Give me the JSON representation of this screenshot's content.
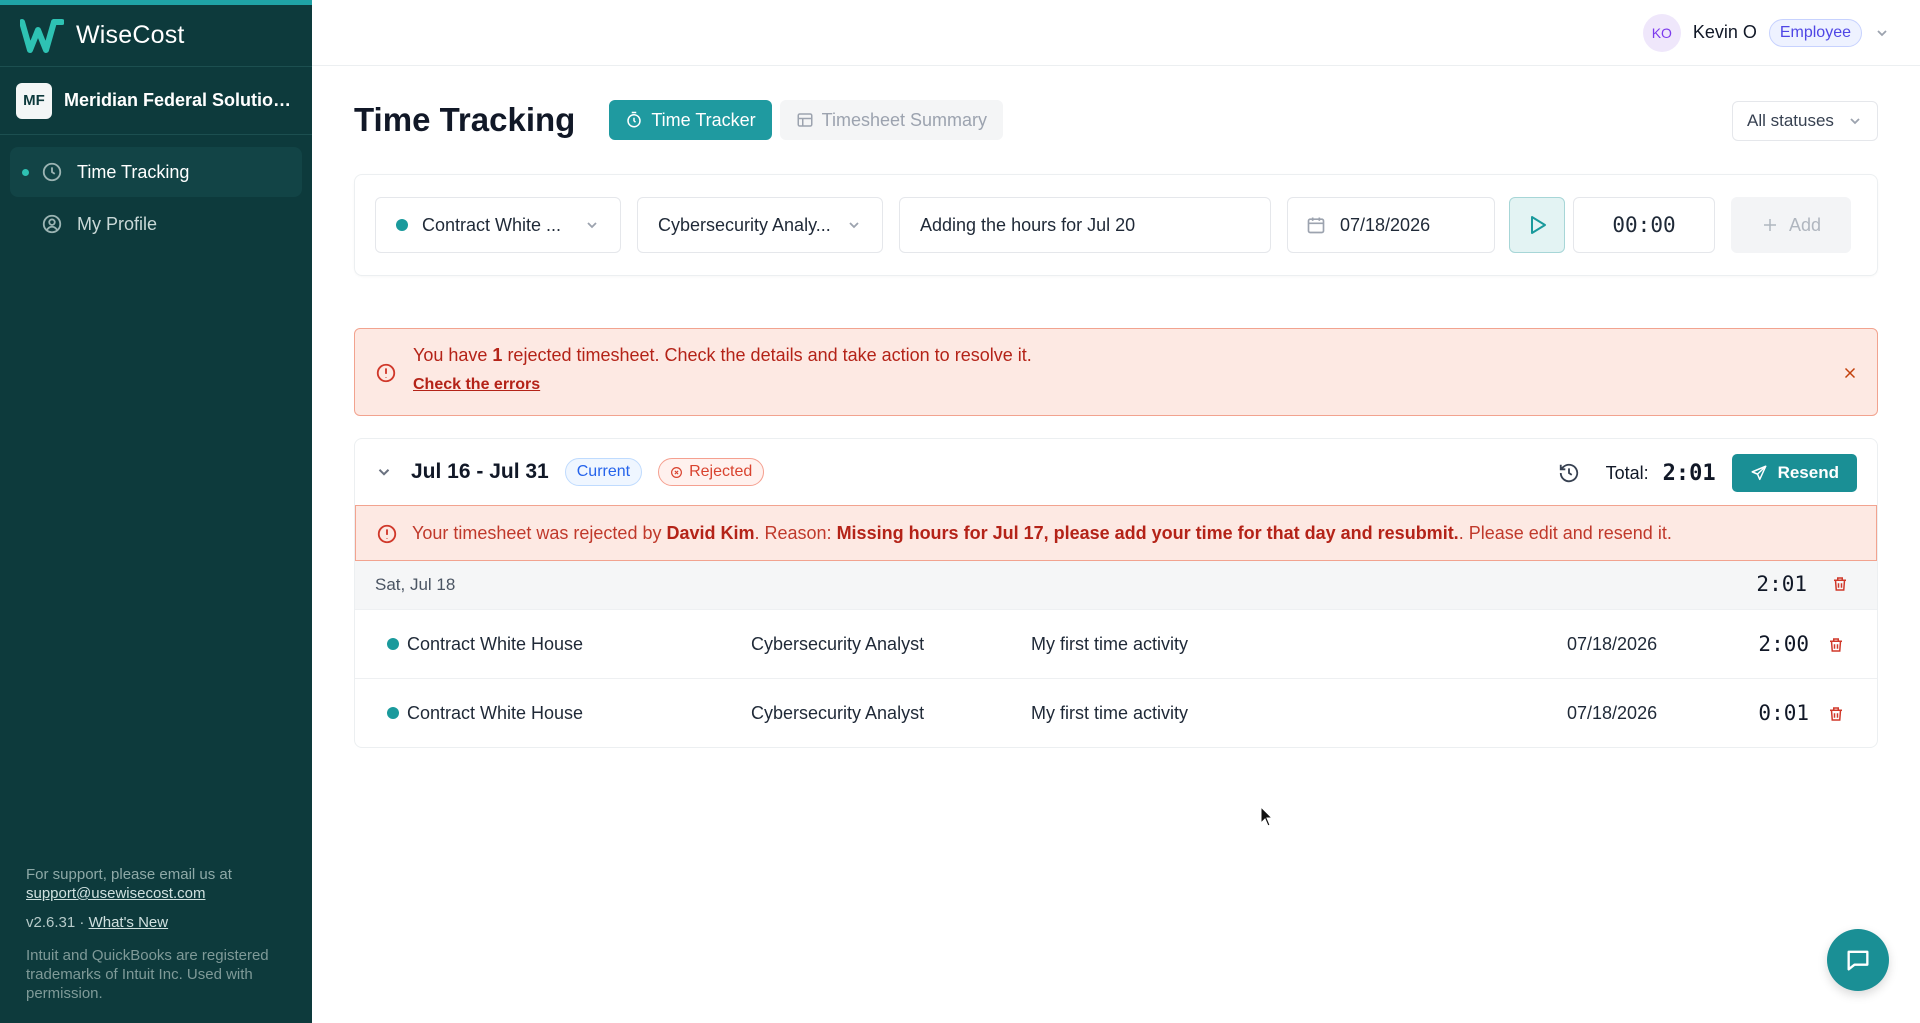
{
  "app": {
    "name": "WiseCost"
  },
  "org": {
    "initials": "MF",
    "name": "Meridian Federal Solutions..."
  },
  "nav": [
    {
      "label": "Time Tracking",
      "icon": "clock-icon",
      "active": true
    },
    {
      "label": "My Profile",
      "icon": "user-circle-icon",
      "active": false
    }
  ],
  "footer": {
    "support_text": "For support, please email us at",
    "support_email": "support@usewisecost.com",
    "version": "v2.6.31",
    "version_sep": " · ",
    "whats_new": "What's New",
    "legal": "Intuit and QuickBooks are registered trademarks of Intuit Inc. Used with permission."
  },
  "user": {
    "initials": "KO",
    "name": "Kevin O",
    "role": "Employee"
  },
  "page": {
    "title": "Time Tracking",
    "tabs": [
      {
        "label": "Time Tracker",
        "active": true
      },
      {
        "label": "Timesheet Summary",
        "active": false
      }
    ],
    "status_filter": "All statuses"
  },
  "entry_form": {
    "project": "Contract White ...",
    "role": "Cybersecurity Analy...",
    "description": "Adding the hours for Jul 20",
    "date": "07/18/2026",
    "timer": "00:00",
    "add_label": "Add"
  },
  "alert": {
    "prefix": "You have ",
    "count": "1",
    "suffix": " rejected timesheet. Check the details and take action to resolve it.",
    "link": "Check the errors"
  },
  "timesheet": {
    "period": "Jul 16 - Jul 31",
    "current_badge": "Current",
    "status_badge": "Rejected",
    "total_label": "Total:",
    "total_value": "2:01",
    "resend_label": "Resend",
    "rejection": {
      "prefix": "Your timesheet was rejected by ",
      "reviewer": "David Kim",
      "mid": ". Reason: ",
      "reason": "Missing hours for Jul 17, please add your time for that day and resubmit.",
      "suffix": ". Please edit and resend it."
    },
    "days": [
      {
        "label": "Sat, Jul 18",
        "total": "2:01",
        "entries": [
          {
            "project": "Contract White House",
            "role": "Cybersecurity Analyst",
            "description": "My first time activity",
            "date": "07/18/2026",
            "duration": "2:00"
          },
          {
            "project": "Contract White House",
            "role": "Cybersecurity Analyst",
            "description": "My first time activity",
            "date": "07/18/2026",
            "duration": "0:01"
          }
        ]
      }
    ]
  },
  "colors": {
    "sidebar": "#0d3a3c",
    "accent": "#1a8f95",
    "danger": "#d0382a",
    "alert_bg": "#fde9e3"
  }
}
